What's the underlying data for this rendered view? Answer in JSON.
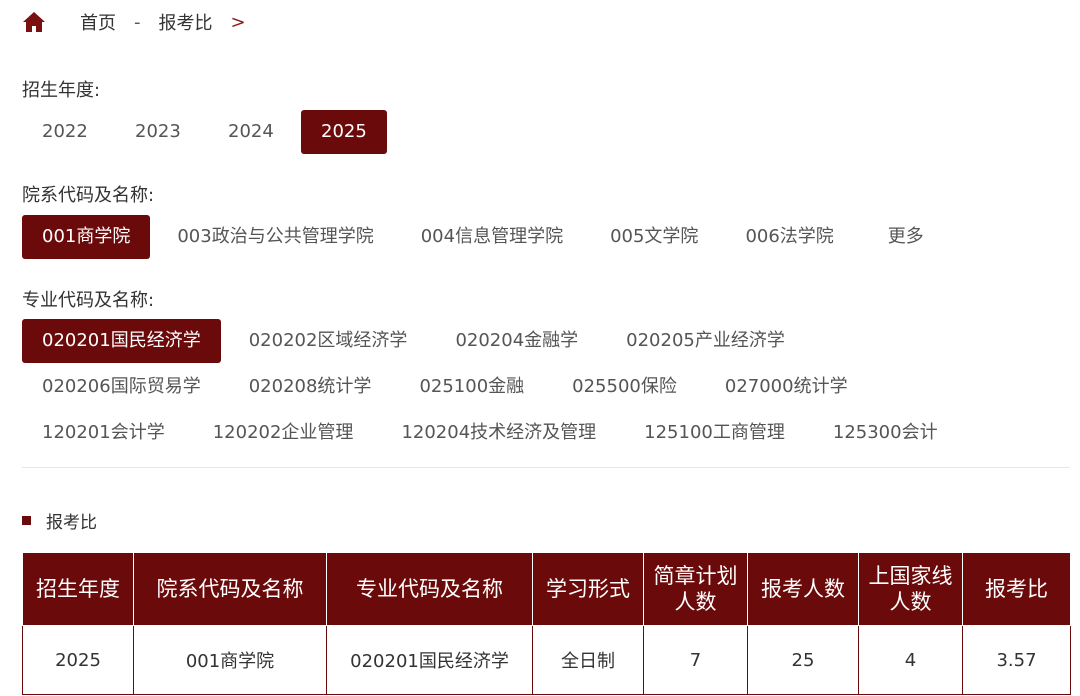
{
  "breadcrumb": {
    "home": "首页",
    "separator": "-",
    "current": "报考比",
    "arrow": ">"
  },
  "year_filter": {
    "label": "招生年度:",
    "options": [
      "2022",
      "2023",
      "2024",
      "2025"
    ],
    "selected": "2025"
  },
  "department_filter": {
    "label": "院系代码及名称:",
    "options": [
      "001商学院",
      "003政治与公共管理学院",
      "004信息管理学院",
      "005文学院",
      "006法学院",
      "更多"
    ],
    "selected": "001商学院"
  },
  "major_filter": {
    "label": "专业代码及名称:",
    "options": [
      "020201国民经济学",
      "020202区域经济学",
      "020204金融学",
      "020205产业经济学",
      "020206国际贸易学",
      "020208统计学",
      "025100金融",
      "025500保险",
      "027000统计学",
      "120201会计学",
      "120202企业管理",
      "120204技术经济及管理",
      "125100工商管理",
      "125300会计"
    ],
    "selected": "020201国民经济学"
  },
  "section": {
    "title": "报考比"
  },
  "table": {
    "headers": [
      "招生年度",
      "院系代码及名称",
      "专业代码及名称",
      "学习形式",
      "简章计划人数",
      "报考人数",
      "上国家线人数",
      "报考比"
    ],
    "rows": [
      [
        "2025",
        "001商学院",
        "020201国民经济学",
        "全日制",
        "7",
        "25",
        "4",
        "3.57"
      ]
    ]
  },
  "colors": {
    "accent": "#6b0a0a",
    "text": "#333333",
    "muted": "#555555"
  },
  "icons": {
    "home": "home-icon"
  }
}
